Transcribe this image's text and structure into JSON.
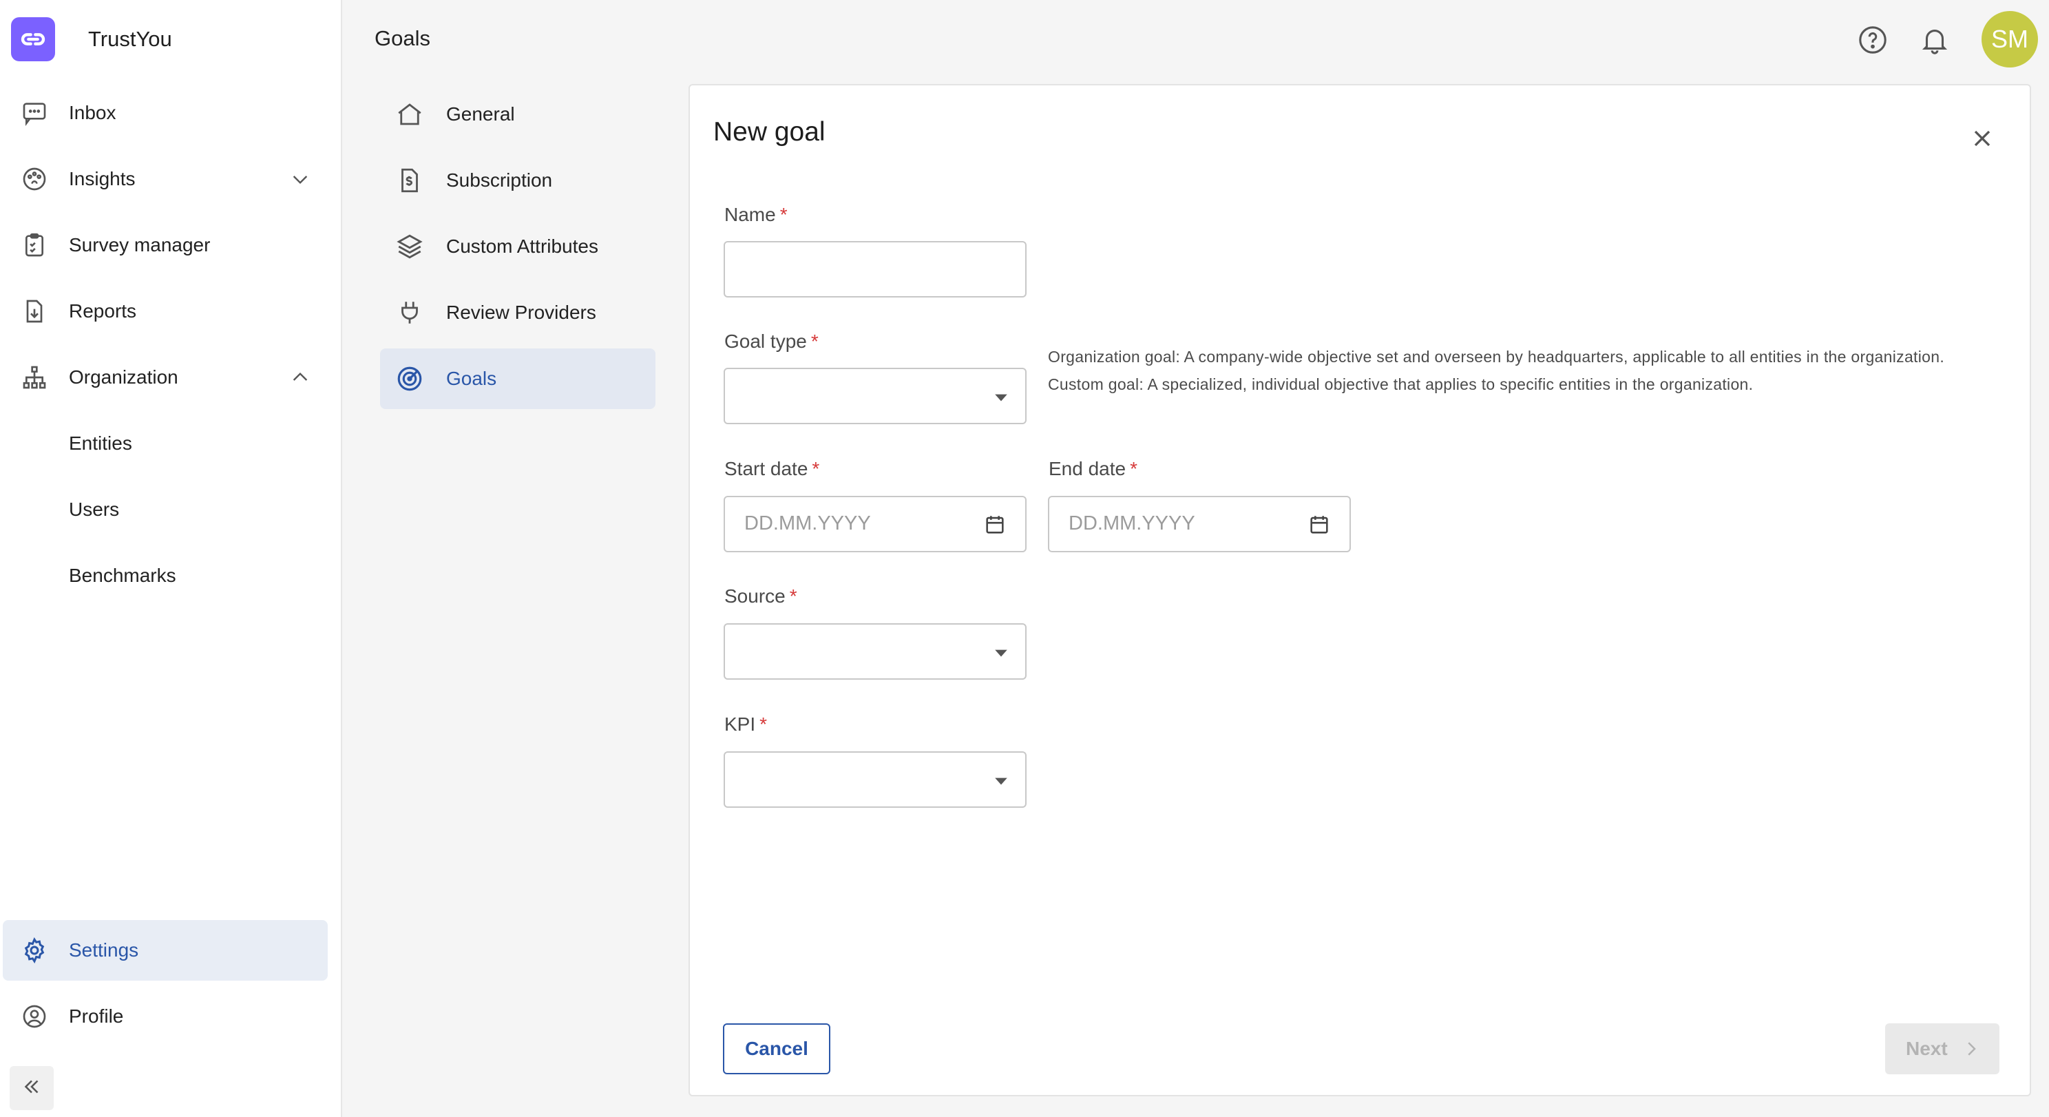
{
  "app": {
    "name": "TrustYou"
  },
  "sidebar": {
    "items": [
      {
        "label": "Inbox",
        "icon": "chat-bubble-icon"
      },
      {
        "label": "Insights",
        "icon": "palette-icon"
      },
      {
        "label": "Survey manager",
        "icon": "clipboard-icon"
      },
      {
        "label": "Reports",
        "icon": "download-file-icon"
      },
      {
        "label": "Organization",
        "icon": "org-chart-icon"
      },
      {
        "label": "Entities"
      },
      {
        "label": "Users"
      },
      {
        "label": "Benchmarks"
      }
    ],
    "settings_label": "Settings",
    "profile_label": "Profile"
  },
  "header": {
    "title": "Goals",
    "avatar_initials": "SM",
    "avatar_color": "#c6ca45"
  },
  "settings_menu": {
    "items": [
      {
        "label": "General",
        "icon": "home-icon"
      },
      {
        "label": "Subscription",
        "icon": "invoice-icon"
      },
      {
        "label": "Custom Attributes",
        "icon": "layers-icon"
      },
      {
        "label": "Review Providers",
        "icon": "plug-icon"
      },
      {
        "label": "Goals",
        "icon": "target-icon",
        "active": true
      }
    ]
  },
  "dialog": {
    "title": "New goal",
    "fields": {
      "name": {
        "label": "Name",
        "required_mark": "*",
        "value": ""
      },
      "goal_type": {
        "label": "Goal type",
        "required_mark": "*",
        "value": ""
      },
      "start_date": {
        "label": "Start date",
        "required_mark": "*",
        "placeholder": "DD.MM.YYYY"
      },
      "end_date": {
        "label": "End date",
        "required_mark": "*",
        "placeholder": "DD.MM.YYYY"
      },
      "source": {
        "label": "Source",
        "required_mark": "*",
        "value": ""
      },
      "kpi": {
        "label": "KPI",
        "required_mark": "*",
        "value": ""
      }
    },
    "goal_type_help": {
      "line1": "Organization goal: A company-wide objective set and overseen by headquarters, applicable to all entities in the organization.",
      "line2": "Custom goal: A specialized, individual objective that applies to specific entities in the organization."
    },
    "cancel_label": "Cancel",
    "next_label": "Next"
  },
  "colors": {
    "accent": "#2a56a8",
    "brand": "#7b61ff",
    "required": "#d63a3a"
  }
}
